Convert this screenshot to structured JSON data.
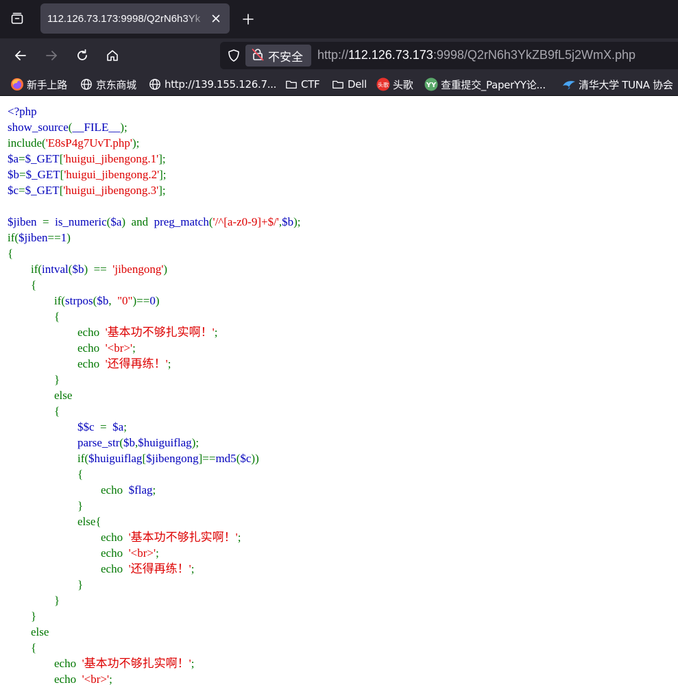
{
  "tab": {
    "title": "112.126.73.173:9998/Q2rN6h3Yk"
  },
  "urlbar": {
    "security_label": "不安全",
    "url_scheme": "http://",
    "url_host": "112.126.73.173",
    "url_rest": ":9998/Q2rN6h3YkZB9fL5j2WmX.php"
  },
  "bookmarks": [
    {
      "label": "新手上路",
      "icon": "firefox-icon"
    },
    {
      "label": "京东商城",
      "icon": "globe-icon"
    },
    {
      "label": "http://139.155.126.7...",
      "icon": "globe-icon"
    },
    {
      "label": "CTF",
      "icon": "folder-icon"
    },
    {
      "label": "Dell",
      "icon": "folder-icon"
    },
    {
      "label": "头歌",
      "icon": "touge-icon"
    },
    {
      "label": "查重提交_PaperYY论...",
      "icon": "paperyy-icon"
    },
    {
      "label": "清华大学 TUNA 协会",
      "icon": "tuna-icon"
    }
  ],
  "colors": {
    "keyword": "#007700",
    "string": "#dd0000",
    "default": "#0000bb"
  },
  "code": [
    [
      [
        "d",
        "<?php"
      ]
    ],
    [
      [
        "d",
        "show_source"
      ],
      [
        "k",
        "("
      ],
      [
        "d",
        "__FILE__"
      ],
      [
        "k",
        ");"
      ]
    ],
    [
      [
        "k",
        "include("
      ],
      [
        "s",
        "'E8sP4g7UvT.php'"
      ],
      [
        "k",
        ");"
      ]
    ],
    [
      [
        "d",
        "$a"
      ],
      [
        "k",
        "="
      ],
      [
        "d",
        "$_GET"
      ],
      [
        "k",
        "["
      ],
      [
        "s",
        "'huigui_jibengong.1'"
      ],
      [
        "k",
        "];"
      ]
    ],
    [
      [
        "d",
        "$b"
      ],
      [
        "k",
        "="
      ],
      [
        "d",
        "$_GET"
      ],
      [
        "k",
        "["
      ],
      [
        "s",
        "'huigui_jibengong.2'"
      ],
      [
        "k",
        "];"
      ]
    ],
    [
      [
        "d",
        "$c"
      ],
      [
        "k",
        "="
      ],
      [
        "d",
        "$_GET"
      ],
      [
        "k",
        "["
      ],
      [
        "s",
        "'huigui_jibengong.3'"
      ],
      [
        "k",
        "];"
      ]
    ],
    [],
    [
      [
        "d",
        "$jiben  "
      ],
      [
        "k",
        "=  "
      ],
      [
        "d",
        "is_numeric"
      ],
      [
        "k",
        "("
      ],
      [
        "d",
        "$a"
      ],
      [
        "k",
        ")  and  "
      ],
      [
        "d",
        "preg_match"
      ],
      [
        "k",
        "("
      ],
      [
        "s",
        "'/^[a-z0-9]+$/'"
      ],
      [
        "k",
        ","
      ],
      [
        "d",
        "$b"
      ],
      [
        "k",
        ");"
      ]
    ],
    [
      [
        "k",
        "if("
      ],
      [
        "d",
        "$jiben"
      ],
      [
        "k",
        "=="
      ],
      [
        "d",
        "1"
      ],
      [
        "k",
        ")"
      ]
    ],
    [
      [
        "k",
        "{"
      ]
    ],
    [
      [
        "k",
        "        if("
      ],
      [
        "d",
        "intval"
      ],
      [
        "k",
        "("
      ],
      [
        "d",
        "$b"
      ],
      [
        "k",
        ")  ==  "
      ],
      [
        "s",
        "'jibengong'"
      ],
      [
        "k",
        ")"
      ]
    ],
    [
      [
        "k",
        "        {"
      ]
    ],
    [
      [
        "k",
        "                if("
      ],
      [
        "d",
        "strpos"
      ],
      [
        "k",
        "("
      ],
      [
        "d",
        "$b"
      ],
      [
        "k",
        ",  "
      ],
      [
        "s",
        "\"0\""
      ],
      [
        "k",
        ")=="
      ],
      [
        "d",
        "0"
      ],
      [
        "k",
        ")"
      ]
    ],
    [
      [
        "k",
        "                {"
      ]
    ],
    [
      [
        "k",
        "                        echo  "
      ],
      [
        "s",
        "'基本功不够扎实啊！'"
      ],
      [
        "k",
        ";"
      ]
    ],
    [
      [
        "k",
        "                        echo  "
      ],
      [
        "s",
        "'<br>'"
      ],
      [
        "k",
        ";"
      ]
    ],
    [
      [
        "k",
        "                        echo  "
      ],
      [
        "s",
        "'还得再练！'"
      ],
      [
        "k",
        ";"
      ]
    ],
    [
      [
        "k",
        "                }"
      ]
    ],
    [
      [
        "k",
        "                else"
      ]
    ],
    [
      [
        "k",
        "                {"
      ]
    ],
    [
      [
        "k",
        "                        "
      ],
      [
        "d",
        "$$c  "
      ],
      [
        "k",
        "=  "
      ],
      [
        "d",
        "$a"
      ],
      [
        "k",
        ";"
      ]
    ],
    [
      [
        "k",
        "                        "
      ],
      [
        "d",
        "parse_str"
      ],
      [
        "k",
        "("
      ],
      [
        "d",
        "$b"
      ],
      [
        "k",
        ","
      ],
      [
        "d",
        "$huiguiflag"
      ],
      [
        "k",
        ");"
      ]
    ],
    [
      [
        "k",
        "                        if("
      ],
      [
        "d",
        "$huiguiflag"
      ],
      [
        "k",
        "["
      ],
      [
        "d",
        "$jibengong"
      ],
      [
        "k",
        "]=="
      ],
      [
        "d",
        "md5"
      ],
      [
        "k",
        "("
      ],
      [
        "d",
        "$c"
      ],
      [
        "k",
        "))"
      ]
    ],
    [
      [
        "k",
        "                        {"
      ]
    ],
    [
      [
        "k",
        "                                echo  "
      ],
      [
        "d",
        "$flag"
      ],
      [
        "k",
        ";"
      ]
    ],
    [
      [
        "k",
        "                        }"
      ]
    ],
    [
      [
        "k",
        "                        else{"
      ]
    ],
    [
      [
        "k",
        "                                echo  "
      ],
      [
        "s",
        "'基本功不够扎实啊！'"
      ],
      [
        "k",
        ";"
      ]
    ],
    [
      [
        "k",
        "                                echo  "
      ],
      [
        "s",
        "'<br>'"
      ],
      [
        "k",
        ";"
      ]
    ],
    [
      [
        "k",
        "                                echo  "
      ],
      [
        "s",
        "'还得再练！'"
      ],
      [
        "k",
        ";"
      ]
    ],
    [
      [
        "k",
        "                        }"
      ]
    ],
    [
      [
        "k",
        "                }"
      ]
    ],
    [
      [
        "k",
        "        }"
      ]
    ],
    [
      [
        "k",
        "        else"
      ]
    ],
    [
      [
        "k",
        "        {"
      ]
    ],
    [
      [
        "k",
        "                echo  "
      ],
      [
        "s",
        "'基本功不够扎实啊！'"
      ],
      [
        "k",
        ";"
      ]
    ],
    [
      [
        "k",
        "                echo  "
      ],
      [
        "s",
        "'<br>'"
      ],
      [
        "k",
        ";"
      ]
    ]
  ]
}
